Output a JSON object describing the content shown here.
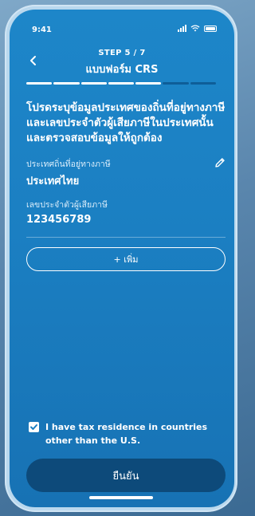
{
  "status_bar": {
    "time": "9:41"
  },
  "header": {
    "step_label": "STEP 5 / 7",
    "title": "แบบฟอร์ม CRS",
    "progress": {
      "total_steps": 7,
      "completed_steps": 5
    }
  },
  "instructions": "โปรดระบุข้อมูลประเทศของถิ่นที่อยู่ทางภาษี และเลขประจำตัวผู้เสียภาษีในประเทศนั้น และตรวจสอบข้อมูลให้ถูกต้อง",
  "tax_residence": {
    "country_label": "ประเทศถิ่นที่อยู่ทางภาษี",
    "country_value": "ประเทศไทย",
    "tin_label": "เลขประจำตัวผู้เสียภาษี",
    "tin_value": "123456789"
  },
  "add_button_label": "+ เพิ่ม",
  "consent": {
    "checked": true,
    "text": "I have tax residence in countries other than the U.S."
  },
  "confirm_button_label": "ยืนยัน",
  "colors": {
    "screen_bg": "#1b7fc2",
    "progress_done": "#ffffff",
    "progress_todo": "#0e5e98",
    "confirm_button": "#0d4a7a"
  },
  "icons": {
    "back": "chevron-left-icon",
    "edit": "pencil-icon",
    "checkbox": "check-icon"
  }
}
